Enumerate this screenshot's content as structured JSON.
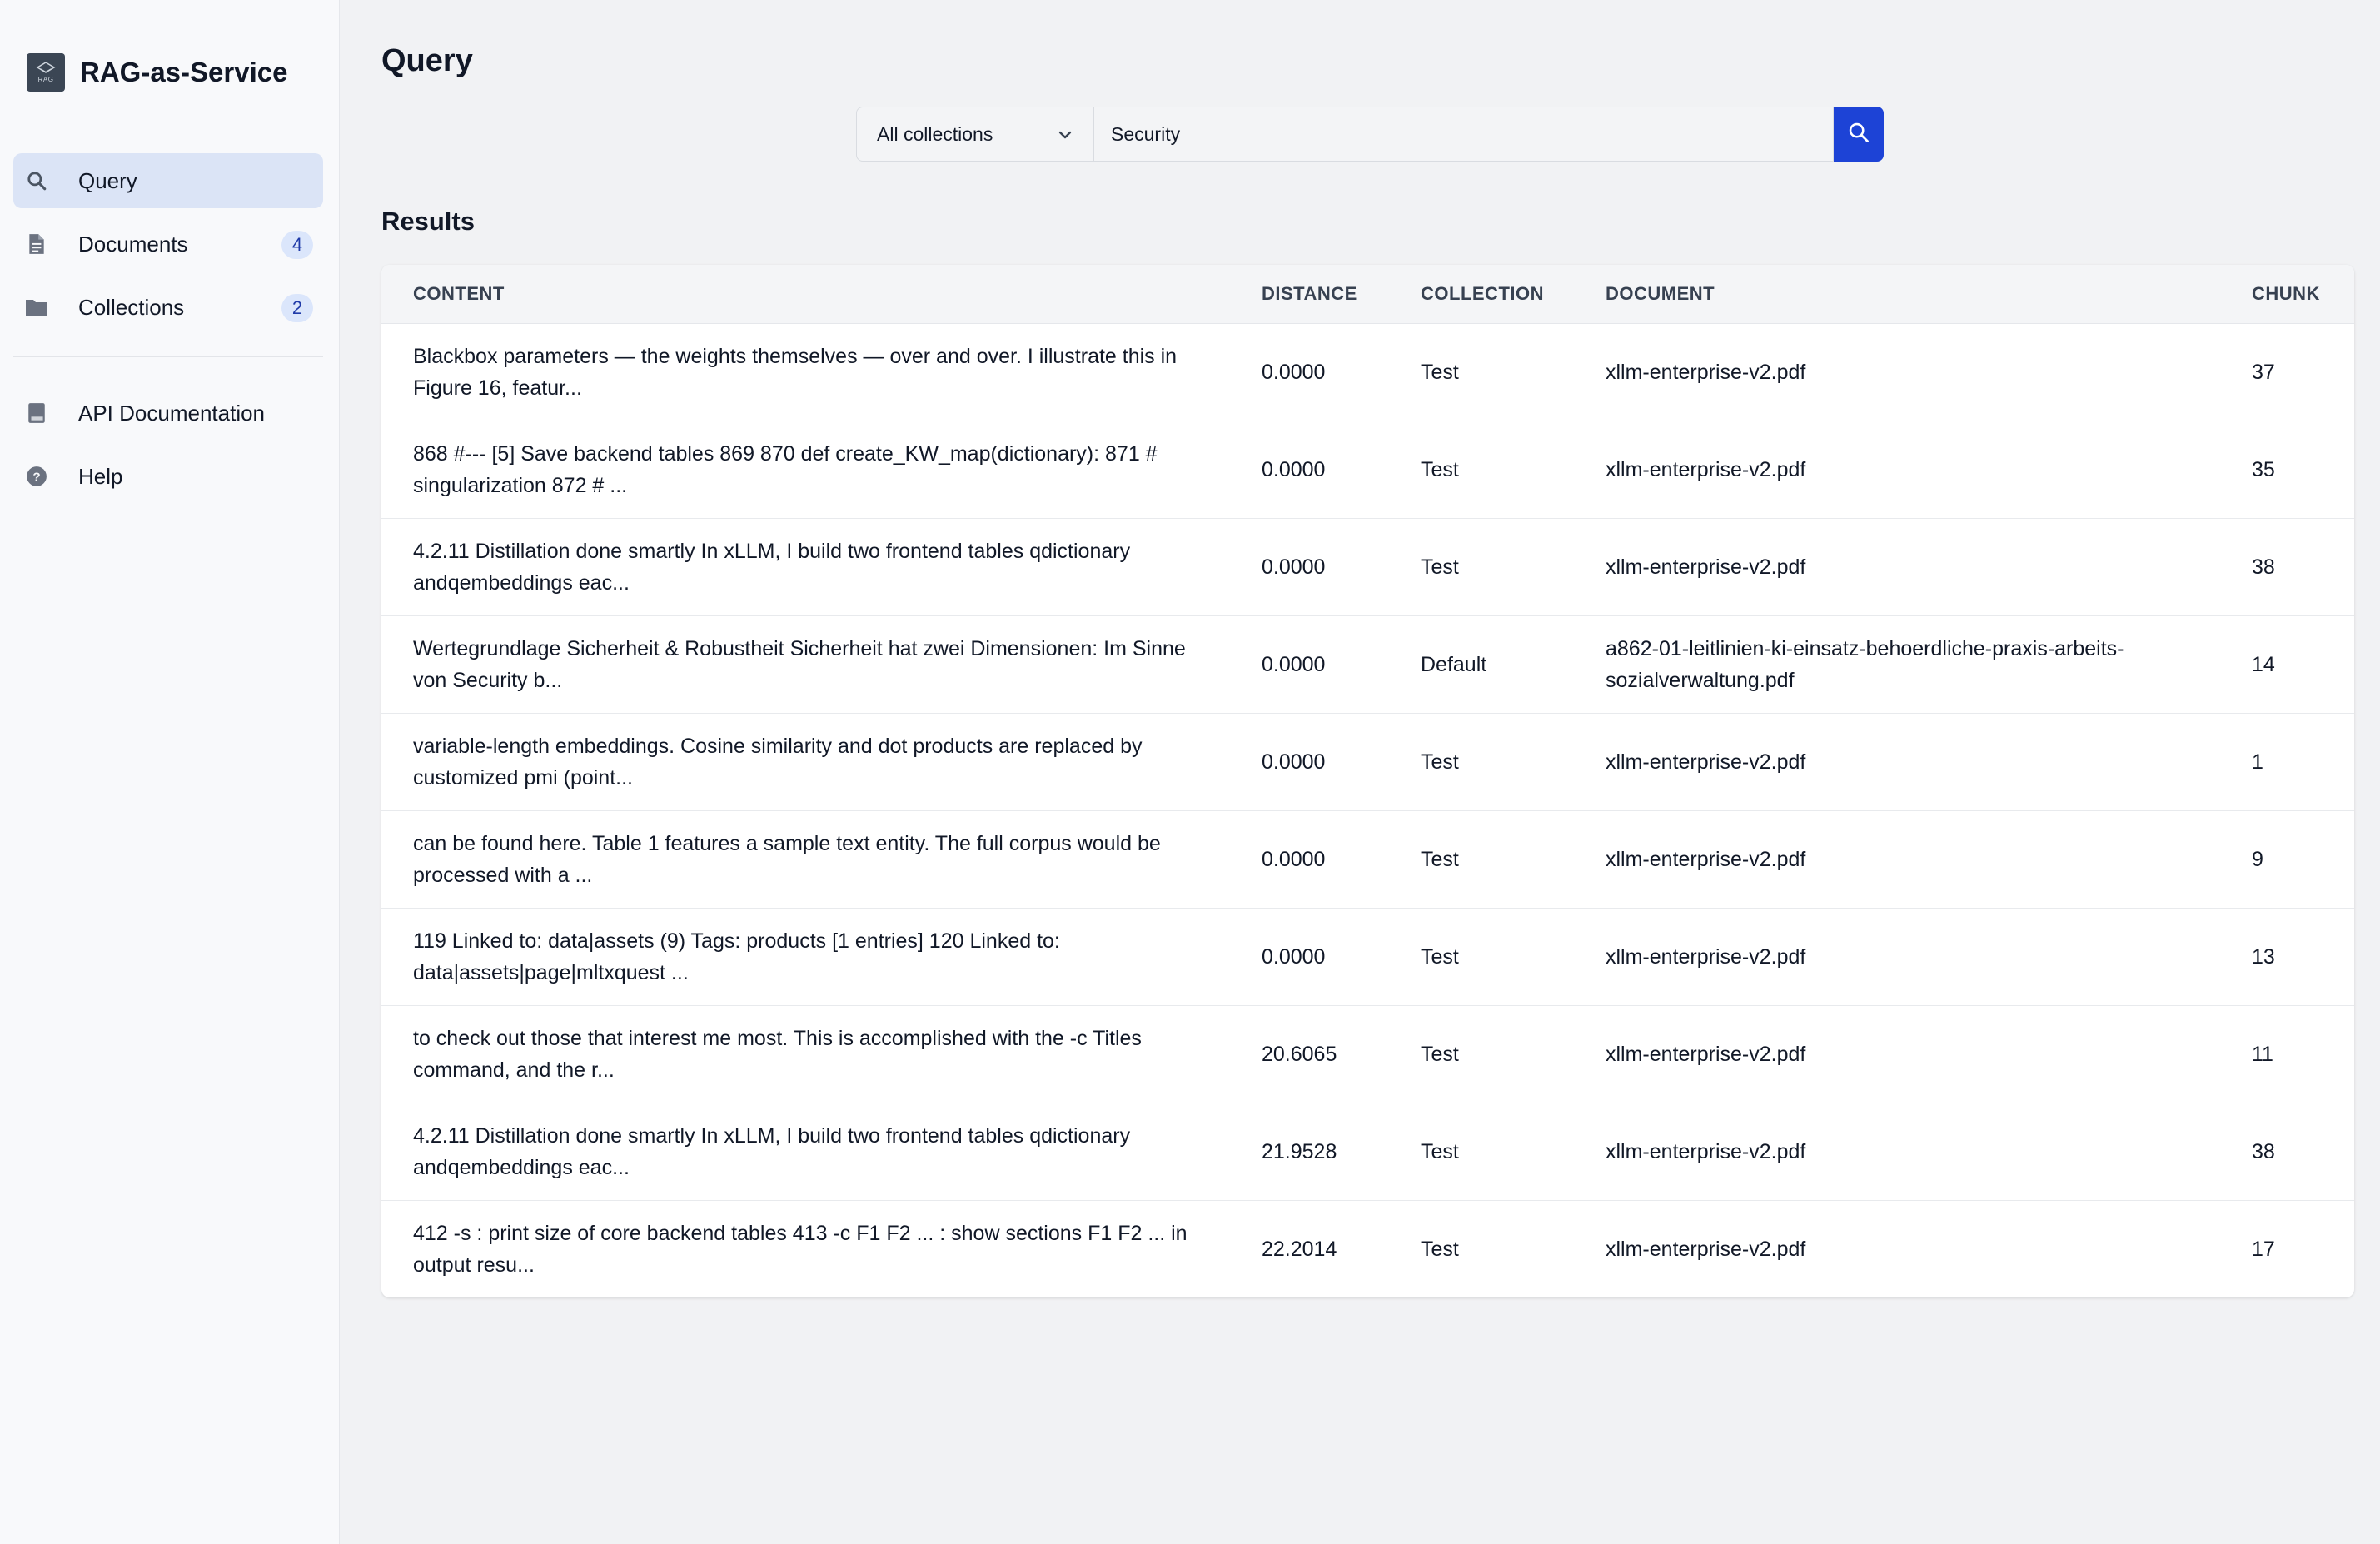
{
  "app": {
    "name": "RAG-as-Service",
    "logo_text": "RAG"
  },
  "sidebar": {
    "items": [
      {
        "label": "Query",
        "icon": "search-icon",
        "active": true
      },
      {
        "label": "Documents",
        "icon": "document-icon",
        "badge": "4"
      },
      {
        "label": "Collections",
        "icon": "folder-icon",
        "badge": "2"
      }
    ],
    "secondary": [
      {
        "label": "API Documentation",
        "icon": "book-icon"
      },
      {
        "label": "Help",
        "icon": "help-circle-icon"
      }
    ]
  },
  "page": {
    "title": "Query"
  },
  "search": {
    "collection_selected": "All collections",
    "query_value": "Security"
  },
  "results": {
    "title": "Results",
    "columns": [
      "CONTENT",
      "DISTANCE",
      "COLLECTION",
      "DOCUMENT",
      "CHUNK"
    ],
    "rows": [
      {
        "content": "Blackbox parameters — the weights themselves — over and over. I illustrate this in Figure 16, featur...",
        "distance": "0.0000",
        "collection": "Test",
        "document": "xllm-enterprise-v2.pdf",
        "chunk": "37"
      },
      {
        "content": "868 #--- [5] Save backend tables 869 870 def create_KW_map(dictionary): 871 # singularization 872 # ...",
        "distance": "0.0000",
        "collection": "Test",
        "document": "xllm-enterprise-v2.pdf",
        "chunk": "35"
      },
      {
        "content": "4.2.11 Distillation done smartly In xLLM, I build two frontend tables qdictionary andqembeddings eac...",
        "distance": "0.0000",
        "collection": "Test",
        "document": "xllm-enterprise-v2.pdf",
        "chunk": "38"
      },
      {
        "content": "Wertegrundlage Sicherheit & Robustheit Sicherheit hat zwei Dimensionen: Im Sinne von Security b...",
        "distance": "0.0000",
        "collection": "Default",
        "document": "a862-01-leitlinien-ki-einsatz-behoerdliche-praxis-arbeits-sozialverwaltung.pdf",
        "chunk": "14"
      },
      {
        "content": "variable-length embeddings. Cosine similarity and dot products are replaced by customized pmi (point...",
        "distance": "0.0000",
        "collection": "Test",
        "document": "xllm-enterprise-v2.pdf",
        "chunk": "1"
      },
      {
        "content": "can be found here. Table 1 features a sample text entity. The full corpus would be processed with a ...",
        "distance": "0.0000",
        "collection": "Test",
        "document": "xllm-enterprise-v2.pdf",
        "chunk": "9"
      },
      {
        "content": "119 Linked to: data|assets (9) Tags: products [1 entries] 120 Linked to: data|assets|page|mltxquest ...",
        "distance": "0.0000",
        "collection": "Test",
        "document": "xllm-enterprise-v2.pdf",
        "chunk": "13"
      },
      {
        "content": "to check out those that interest me most. This is accomplished with the -c Titles command, and the r...",
        "distance": "20.6065",
        "collection": "Test",
        "document": "xllm-enterprise-v2.pdf",
        "chunk": "11"
      },
      {
        "content": "4.2.11 Distillation done smartly In xLLM, I build two frontend tables qdictionary andqembeddings eac...",
        "distance": "21.9528",
        "collection": "Test",
        "document": "xllm-enterprise-v2.pdf",
        "chunk": "38"
      },
      {
        "content": "412 -s : print size of core backend tables 413 -c F1 F2 ... : show sections F1 F2 ... in output resu...",
        "distance": "22.2014",
        "collection": "Test",
        "document": "xllm-enterprise-v2.pdf",
        "chunk": "17"
      }
    ]
  },
  "colors": {
    "accent": "#1d43d6",
    "active_nav": "#dbe4f6",
    "badge_bg": "#dbe6fb"
  }
}
